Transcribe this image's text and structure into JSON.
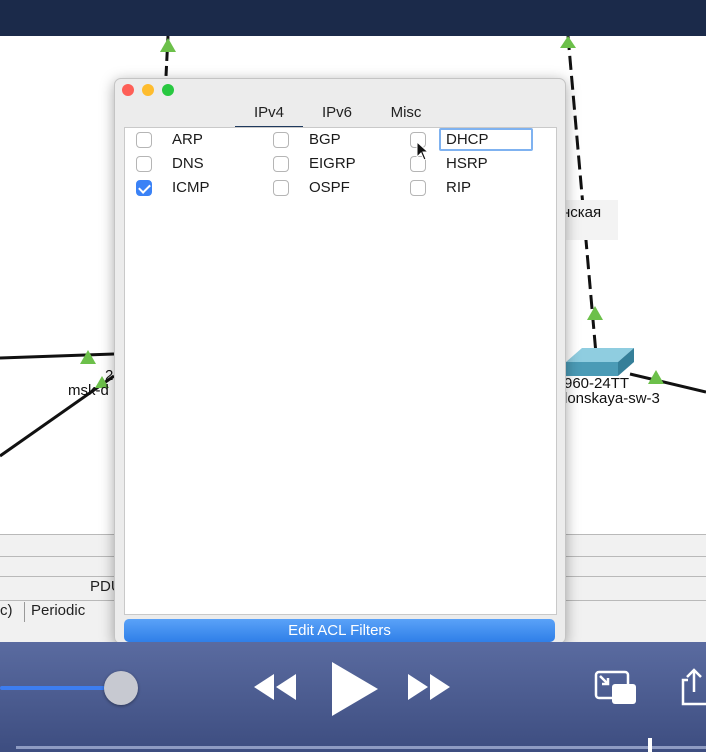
{
  "topology": {
    "label_1": "нская",
    "label_2": "960-24TT",
    "label_3": "lonskaya-sw-3",
    "label_4": "2",
    "label_5": "msk-d"
  },
  "bottom_panel": {
    "header_label": "PDU",
    "col_left": "c)",
    "col_periodic": "Periodic"
  },
  "filter_dialog": {
    "tabs": [
      {
        "label": "IPv4",
        "active": true
      },
      {
        "label": "IPv6",
        "active": false
      },
      {
        "label": "Misc",
        "active": false
      }
    ],
    "protocols": [
      {
        "label": "ARP",
        "checked": false
      },
      {
        "label": "BGP",
        "checked": false
      },
      {
        "label": "DHCP",
        "checked": false
      },
      {
        "label": "DNS",
        "checked": false
      },
      {
        "label": "EIGRP",
        "checked": false
      },
      {
        "label": "HSRP",
        "checked": false
      },
      {
        "label": "ICMP",
        "checked": true
      },
      {
        "label": "OSPF",
        "checked": false
      },
      {
        "label": "RIP",
        "checked": false
      }
    ],
    "edit_acl_button": "Edit ACL Filters"
  },
  "player": {
    "progress_fraction": 0.92,
    "volume_fraction": 0.17
  },
  "colors": {
    "accent": "#3b82f6",
    "link_green": "#6cc04a",
    "title_bar": "#1b2a4a",
    "switch": "#4b9bb6"
  },
  "icons": [
    "rewind-icon",
    "play-icon",
    "fast-forward-icon",
    "picture-in-picture-icon",
    "share-icon",
    "cursor-icon"
  ]
}
